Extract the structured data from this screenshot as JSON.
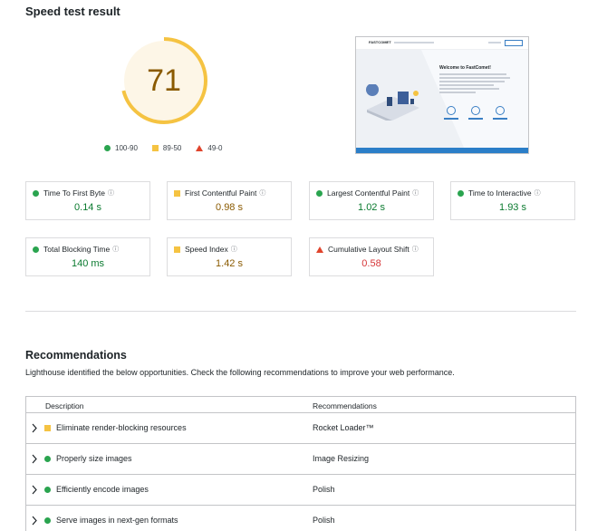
{
  "page": {
    "title": "Speed test result"
  },
  "score": {
    "value": "71",
    "fraction": 0.71,
    "color": "#f5c342"
  },
  "legend": [
    {
      "marker": "green-dot",
      "label": "100-90",
      "color": "#2aa44f"
    },
    {
      "marker": "orange-square",
      "label": "89-50",
      "color": "#f5c342"
    },
    {
      "marker": "red-triangle",
      "label": "49-0",
      "color": "#e0442c"
    }
  ],
  "thumbnail": {
    "logo": "FASTCOMET",
    "heading": "Welcome to FastComet!"
  },
  "metrics": [
    {
      "label": "Time To First Byte",
      "value": "0.14 s",
      "status": "good",
      "icon": "info-icon"
    },
    {
      "label": "First Contentful Paint",
      "value": "0.98 s",
      "status": "average",
      "icon": "info-icon"
    },
    {
      "label": "Largest Contentful Paint",
      "value": "1.02 s",
      "status": "good",
      "icon": "info-icon"
    },
    {
      "label": "Time to Interactive",
      "value": "1.93 s",
      "status": "good",
      "icon": "info-icon"
    },
    {
      "label": "Total Blocking Time",
      "value": "140 ms",
      "status": "good",
      "icon": "info-icon"
    },
    {
      "label": "Speed Index",
      "value": "1.42 s",
      "status": "average",
      "icon": "info-icon"
    },
    {
      "label": "Cumulative Layout Shift",
      "value": "0.58",
      "status": "poor",
      "icon": "info-icon"
    }
  ],
  "info_glyph": "ⓘ",
  "recommendations": {
    "title": "Recommendations",
    "description": "Lighthouse identified the below opportunities. Check the following recommendations to improve your web performance.",
    "columns": {
      "description": "Description",
      "recommendations": "Recommendations"
    },
    "rows": [
      {
        "description": "Eliminate render-blocking resources",
        "recommendation": "Rocket Loader™",
        "status": "average"
      },
      {
        "description": "Properly size images",
        "recommendation": "Image Resizing",
        "status": "good"
      },
      {
        "description": "Efficiently encode images",
        "recommendation": "Polish",
        "status": "good"
      },
      {
        "description": "Serve images in next-gen formats",
        "recommendation": "Polish",
        "status": "good"
      }
    ]
  }
}
